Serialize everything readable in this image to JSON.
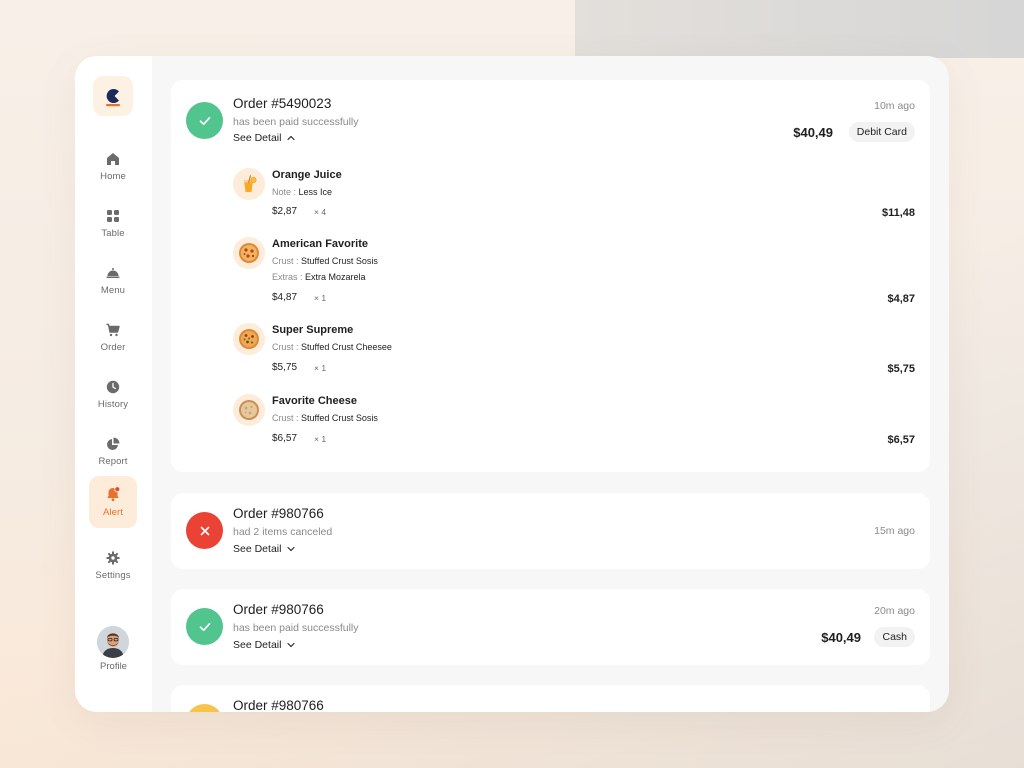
{
  "sidebar": {
    "items": [
      {
        "label": "Home",
        "icon": "home-icon"
      },
      {
        "label": "Table",
        "icon": "grid-icon"
      },
      {
        "label": "Menu",
        "icon": "cloche-icon"
      },
      {
        "label": "Order",
        "icon": "cart-icon"
      },
      {
        "label": "History",
        "icon": "clock-icon"
      },
      {
        "label": "Report",
        "icon": "pie-chart-icon"
      },
      {
        "label": "Alert",
        "icon": "bell-icon",
        "active": true
      },
      {
        "label": "Settings",
        "icon": "gear-icon"
      }
    ],
    "profile_label": "Profile"
  },
  "colors": {
    "accent": "#e8722b",
    "success": "#52c48d",
    "error": "#ea4335",
    "warning": "#f8c34a"
  },
  "orders": [
    {
      "title": "Order #5490023",
      "subtitle": "has been paid successfully",
      "see_detail": "See Detail",
      "expanded": true,
      "status": "success",
      "time": "10m ago",
      "amount": "$40,49",
      "payment": "Debit Card",
      "items": [
        {
          "name": "Orange Juice",
          "notes": [
            {
              "key": "Note : ",
              "value": "Less Ice"
            }
          ],
          "price": "$2,87",
          "qty": "× 4",
          "total": "$11,48",
          "icon": "juice-icon"
        },
        {
          "name": "American Favorite",
          "notes": [
            {
              "key": "Crust : ",
              "value": "Stuffed Crust Sosis"
            },
            {
              "key": "Extras : ",
              "value": "Extra Mozarela"
            }
          ],
          "price": "$4,87",
          "qty": "× 1",
          "total": "$4,87",
          "icon": "pizza-icon"
        },
        {
          "name": "Super Supreme",
          "notes": [
            {
              "key": "Crust : ",
              "value": "Stuffed Crust Cheesee"
            }
          ],
          "price": "$5,75",
          "qty": "× 1",
          "total": "$5,75",
          "icon": "pizza-icon"
        },
        {
          "name": "Favorite Cheese",
          "notes": [
            {
              "key": "Crust : ",
              "value": "Stuffed Crust Sosis"
            }
          ],
          "price": "$6,57",
          "qty": "× 1",
          "total": "$6,57",
          "icon": "pizza-icon"
        }
      ]
    },
    {
      "title": "Order #980766",
      "subtitle": "had 2 items canceled",
      "see_detail": "See Detail",
      "expanded": false,
      "status": "error",
      "time": "15m ago"
    },
    {
      "title": "Order #980766",
      "subtitle": "has been paid successfully",
      "see_detail": "See Detail",
      "expanded": false,
      "status": "success",
      "time": "20m ago",
      "amount": "$40,49",
      "payment": "Cash"
    },
    {
      "title": "Order #980766",
      "status": "warning"
    }
  ]
}
